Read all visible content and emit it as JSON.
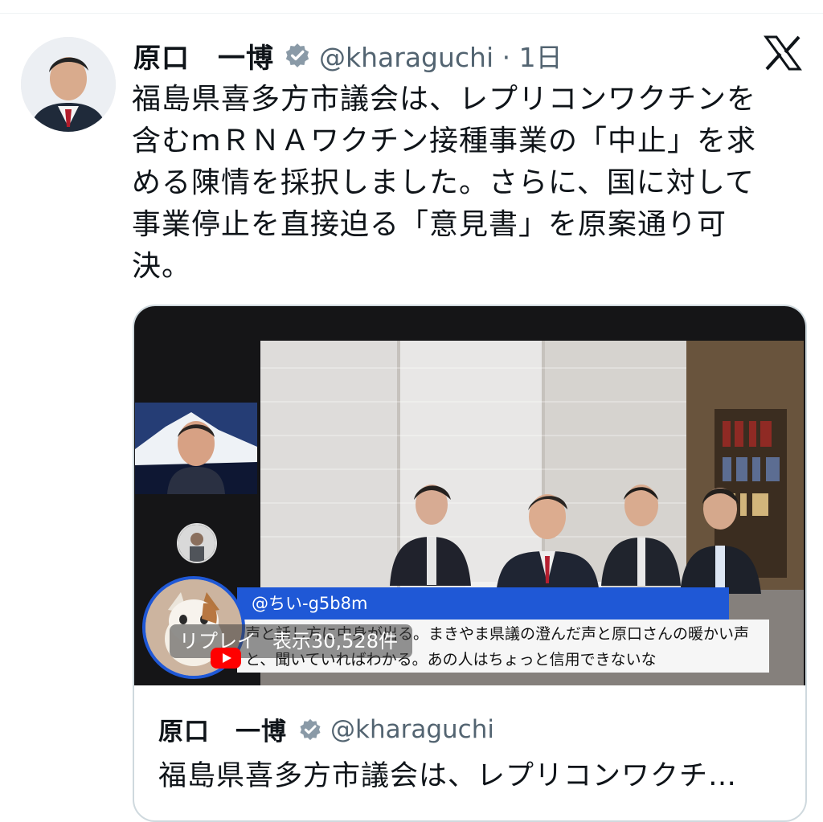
{
  "tweet": {
    "author_name": "原口　一博",
    "handle_time": "@kharaguchi · 1日",
    "text": "福島県喜多方市議会は、レプリコンワクチンを\n含むｍＲＮＡワクチン接種事業の「中止」を求\nめる陳情を採択しました。さらに、国に対して\n事業停止を直接迫る「意見書」を原案通り可\n決。"
  },
  "icons": {
    "verified": "verified-badge-icon",
    "platform": "x-logo-icon",
    "video": "youtube-play-icon"
  },
  "video": {
    "comment_user": "@ちい-g5b8m",
    "comment_text": "声と話し方に中身が出る。まきやま県議の澄んだ声と原口さんの暖かい声と、聞いていればわかる。あの人はちょっと信用できないな",
    "badge_label": "リプレイ",
    "view_count": "表示30,528件"
  },
  "quoted": {
    "author_name": "原口　一博",
    "handle": "@kharaguchi",
    "text": "福島県喜多方市議会は、レプリコンワクチ…"
  },
  "colors": {
    "verified": "#8a9aa7",
    "comment_blue": "#1f58d6",
    "text_primary": "#0f1419",
    "text_secondary": "#536471"
  }
}
